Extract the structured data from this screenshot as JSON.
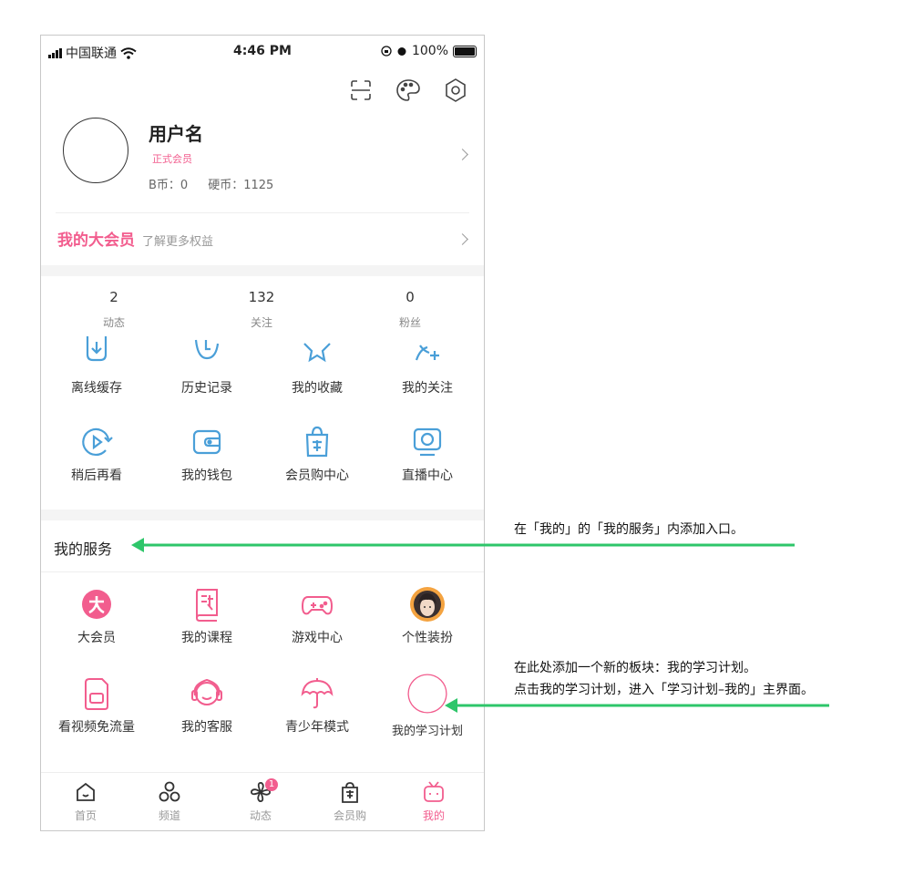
{
  "status_bar": {
    "carrier": "中国联通",
    "time": "4:46 PM",
    "battery": "100%"
  },
  "header_icons": [
    "scan-icon",
    "palette-icon",
    "settings-icon"
  ],
  "profile": {
    "username": "用户名",
    "member_badge": "正式会员",
    "b_coin": "B币：0",
    "hard_coin": "硬币：1125"
  },
  "vip_banner": {
    "title": "我的大会员",
    "subtitle": "了解更多权益"
  },
  "stats": [
    {
      "value": "2",
      "label": "动态"
    },
    {
      "value": "132",
      "label": "关注"
    },
    {
      "value": "0",
      "label": "粉丝"
    }
  ],
  "shortcuts": [
    {
      "label": "离线缓存",
      "icon": "download-icon"
    },
    {
      "label": "历史记录",
      "icon": "history-icon"
    },
    {
      "label": "我的收藏",
      "icon": "star-icon"
    },
    {
      "label": "我的关注",
      "icon": "add-follow-icon"
    },
    {
      "label": "稍后再看",
      "icon": "watch-later-icon"
    },
    {
      "label": "我的钱包",
      "icon": "wallet-icon"
    },
    {
      "label": "会员购中心",
      "icon": "shopping-bag-icon"
    },
    {
      "label": "直播中心",
      "icon": "live-tv-icon"
    }
  ],
  "services": {
    "title": "我的服务",
    "items": [
      {
        "label": "大会员",
        "icon": "vip-icon"
      },
      {
        "label": "我的课程",
        "icon": "course-book-icon"
      },
      {
        "label": "游戏中心",
        "icon": "gamepad-icon"
      },
      {
        "label": "个性装扮",
        "icon": "avatar-theme-icon"
      },
      {
        "label": "看视频免流量",
        "icon": "sim-card-icon"
      },
      {
        "label": "我的客服",
        "icon": "headset-icon"
      },
      {
        "label": "青少年模式",
        "icon": "umbrella-icon"
      },
      {
        "label": "我的学习计划",
        "icon": "study-plan-placeholder-icon"
      }
    ]
  },
  "tab_bar": {
    "items": [
      {
        "label": "首页",
        "icon": "home-icon"
      },
      {
        "label": "频道",
        "icon": "channel-icon"
      },
      {
        "label": "动态",
        "icon": "pinwheel-icon",
        "badge": "1"
      },
      {
        "label": "会员购",
        "icon": "shop-bag-icon"
      },
      {
        "label": "我的",
        "icon": "tv-mine-icon"
      }
    ],
    "active_index": 4
  },
  "annotations": {
    "note_1": "在「我的」的「我的服务」内添加入口。",
    "note_2_line1": "在此处添加一个新的板块：我的学习计划。",
    "note_2_line2": "点击我的学习计划，进入「学习计划–我的」主界面。"
  },
  "colors": {
    "accent_pink": "#f25d8e",
    "icon_blue": "#4a9fd8",
    "arrow_green": "#2ec66a"
  }
}
